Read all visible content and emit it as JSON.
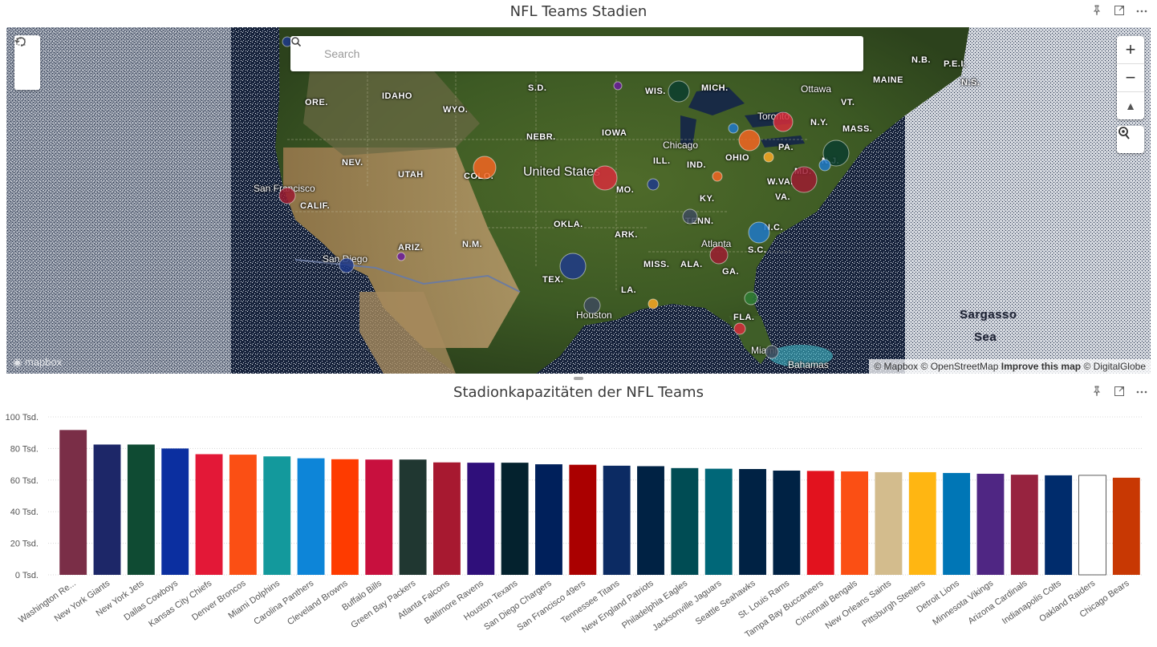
{
  "map_visual": {
    "title": "NFL Teams Stadien",
    "search": {
      "placeholder": "Search"
    },
    "zoom_in": "+",
    "zoom_out": "−",
    "compass": "▲",
    "attribution": {
      "prefix": "© Mapbox © OpenStreetMap",
      "improve": "Improve this map",
      "suffix": "© DigitalGlobe"
    },
    "logo": "mapbox",
    "labels": {
      "states": [
        "ORE.",
        "IDAHO",
        "WYO.",
        "S.D.",
        "WIS.",
        "MICH.",
        "MAINE",
        "N.B.",
        "P.E.I.",
        "N.S.",
        "VT.",
        "N.Y.",
        "MASS.",
        "NEBR.",
        "IOWA",
        "ILL.",
        "IND.",
        "OHIO",
        "PA.",
        "N.J.",
        "MD.",
        "W.VA.",
        "VA.",
        "KY.",
        "NEV.",
        "UTAH",
        "COLO.",
        "CALIF.",
        "MO.",
        "TENN.",
        "N.C.",
        "OKLA.",
        "ARK.",
        "S.C.",
        "ARIZ.",
        "N.M.",
        "MISS.",
        "ALA.",
        "GA.",
        "TEX.",
        "LA.",
        "FLA."
      ],
      "cities": [
        "Ottawa",
        "Toronto",
        "Chicago",
        "San Francisco",
        "San Diego",
        "Atlanta",
        "Houston",
        "Miami",
        "Bahamas"
      ],
      "country": "United States",
      "sea": [
        "Sargasso",
        "Sea"
      ]
    },
    "bubble_colors": [
      "#d62b3a",
      "#f26522",
      "#1e3a8a",
      "#2e7d32",
      "#9b1b30",
      "#f9a825",
      "#3d4a5c",
      "#0b3d2e",
      "#6a1b9a",
      "#1f78c8"
    ]
  },
  "chart_visual": {
    "title": "Stadionkapazitäten der NFL Teams",
    "chart_data": {
      "type": "bar",
      "title": "Stadionkapazitäten der NFL Teams",
      "xlabel": "",
      "ylabel": "",
      "ylim": [
        0,
        100000
      ],
      "yticks": [
        {
          "value": 0,
          "label": "0 Tsd."
        },
        {
          "value": 20000,
          "label": "20 Tsd."
        },
        {
          "value": 40000,
          "label": "40 Tsd."
        },
        {
          "value": 60000,
          "label": "60 Tsd."
        },
        {
          "value": 80000,
          "label": "80 Tsd."
        },
        {
          "value": 100000,
          "label": "100 Tsd."
        }
      ],
      "grid": true,
      "categories": [
        "Washington Re...",
        "New York Giants",
        "New York Jets",
        "Dallas Cowboys",
        "Kansas City Chiefs",
        "Denver Broncos",
        "Miami Dolphins",
        "Carolina Panthers",
        "Cleveland Browns",
        "Buffalo Bills",
        "Green Bay Packers",
        "Atlanta Falcons",
        "Baltimore Ravens",
        "Houston Texans",
        "San Diego Chargers",
        "San Francisco 49ers",
        "Tennessee Titans",
        "New England Patriots",
        "Philadelphia Eagles",
        "Jacksonville Jaguars",
        "Seattle Seahawks",
        "St. Louis Rams",
        "Tampa Bay Buccaneers",
        "Cincinnati Bengals",
        "New Orleans Saints",
        "Pittsburgh Steelers",
        "Detroit Lions",
        "Minnesota Vikings",
        "Arizona Cardinals",
        "Indianapolis Colts",
        "Oakland Raiders",
        "Chicago Bears"
      ],
      "values": [
        91700,
        82500,
        82500,
        80000,
        76400,
        76100,
        75000,
        73800,
        73200,
        73000,
        73000,
        71200,
        71000,
        71000,
        70000,
        69700,
        69100,
        68800,
        67600,
        67200,
        67000,
        66000,
        65800,
        65500,
        65000,
        65000,
        64500,
        64000,
        63400,
        63000,
        63000,
        61500
      ],
      "colors": [
        "#7a2e47",
        "#1d2768",
        "#0f4b33",
        "#0b2fa0",
        "#e31837",
        "#fb4f14",
        "#13999c",
        "#0d85d8",
        "#fe3b00",
        "#c8103e",
        "#203731",
        "#a71930",
        "#2f0f7a",
        "#04222e",
        "#00205b",
        "#aa0000",
        "#0c2b63",
        "#002244",
        "#004c54",
        "#006778",
        "#002244",
        "#002244",
        "#e2121e",
        "#fb4f14",
        "#d3bc8d",
        "#ffb612",
        "#0076b6",
        "#4f2683",
        "#97233f",
        "#002c6c",
        "#ffffff",
        "#c83803"
      ]
    }
  }
}
